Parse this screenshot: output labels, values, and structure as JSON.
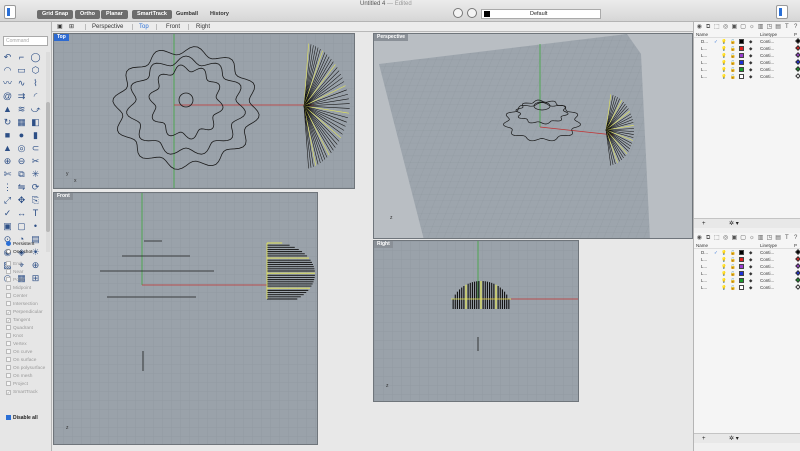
{
  "window": {
    "title": "Untitled 4",
    "status": "— Edited"
  },
  "toolbar": {
    "snaps": [
      {
        "label": "Grid Snap",
        "active": true
      },
      {
        "label": "Ortho",
        "active": true
      },
      {
        "label": "Planar",
        "active": true
      },
      {
        "label": "SmartTrack",
        "active": true
      },
      {
        "label": "Gumball",
        "active": false
      },
      {
        "label": "History",
        "active": false
      }
    ],
    "current_layer": "Default"
  },
  "command": {
    "placeholder": "Command"
  },
  "tool_icons": [
    "curve-icon",
    "polyline-icon",
    "circle-icon",
    "arc-icon",
    "rectangle-icon",
    "polygon-icon",
    "freeform-icon",
    "interpolate-icon",
    "helix-icon",
    "spiral-icon",
    "offset-icon",
    "fillet-icon",
    "extrude-icon",
    "loft-icon",
    "sweep-icon",
    "revolve-icon",
    "network-icon",
    "patch-icon",
    "box-icon",
    "sphere-icon",
    "cylinder-icon",
    "cone-icon",
    "torus-icon",
    "pipe-icon",
    "boolean-union-icon",
    "boolean-diff-icon",
    "split-icon",
    "trim-icon",
    "join-icon",
    "explode-icon",
    "array-icon",
    "mirror-icon",
    "rotate-icon",
    "scale-icon",
    "move-icon",
    "copy-icon",
    "check-icon",
    "dimension-icon",
    "text-icon",
    "group-icon",
    "ungroup-icon",
    "point-icon",
    "analyze-icon",
    "curvature-icon",
    "zebra-icon",
    "render-icon",
    "material-icon",
    "light-icon",
    "snapshot-icon",
    "camera-icon",
    "zoom-icon",
    "target-icon",
    "grid-icon",
    "cplane-icon"
  ],
  "tool_glyphs": [
    "↶",
    "⌐",
    "◯",
    "◠",
    "▭",
    "⬡",
    "〰",
    "∿",
    "⌇",
    "@",
    "⇉",
    "◜",
    "▲",
    "≋",
    "⤻",
    "↻",
    "▦",
    "◧",
    "■",
    "●",
    "▮",
    "▲",
    "◎",
    "⊂",
    "⊕",
    "⊖",
    "✂",
    "✄",
    "⧉",
    "✳",
    "⋮",
    "⇋",
    "⟳",
    "⤢",
    "✥",
    "⎘",
    "✓",
    "↔",
    "T",
    "▣",
    "▢",
    "•",
    "⊙",
    "◔",
    "▤",
    "◉",
    "◈",
    "☀",
    "▧",
    "⌖",
    "⊕",
    "◎",
    "▦",
    "⊞"
  ],
  "osnap": {
    "modes": [
      {
        "label": "Persistent",
        "selected": true
      },
      {
        "label": "One shot",
        "selected": false
      }
    ],
    "items": [
      {
        "label": "End",
        "checked": false
      },
      {
        "label": "Near",
        "checked": false
      },
      {
        "label": "Point",
        "checked": false
      },
      {
        "label": "Midpoint",
        "checked": false
      },
      {
        "label": "Center",
        "checked": false
      },
      {
        "label": "Intersection",
        "checked": false
      },
      {
        "label": "Perpendicular",
        "checked": true
      },
      {
        "label": "Tangent",
        "checked": true
      },
      {
        "label": "Quadrant",
        "checked": false
      },
      {
        "label": "Knot",
        "checked": false
      },
      {
        "label": "Vertex",
        "checked": false
      },
      {
        "label": "On curve",
        "checked": false
      },
      {
        "label": "On surface",
        "checked": false
      },
      {
        "label": "On polysurface",
        "checked": false
      },
      {
        "label": "On mesh",
        "checked": false
      },
      {
        "label": "Project",
        "checked": false
      },
      {
        "label": "SmartTrack",
        "checked": true
      }
    ],
    "disable_all": "Disable all"
  },
  "viewport_tabs": [
    {
      "label": "Perspective",
      "active": false
    },
    {
      "label": "Top",
      "active": true
    },
    {
      "label": "Front",
      "active": false
    },
    {
      "label": "Right",
      "active": false
    }
  ],
  "viewports": {
    "top": {
      "label": "Top"
    },
    "perspective": {
      "label": "Perspective"
    },
    "front": {
      "label": "Front"
    },
    "right": {
      "label": "Right"
    }
  },
  "layers": {
    "columns": [
      "Name",
      "Linetype",
      "P"
    ],
    "rows": [
      {
        "name": "D...",
        "linetype": "Conti... ",
        "color": "#000000"
      },
      {
        "name": "L...",
        "linetype": "Conti... ",
        "color": "#e02020"
      },
      {
        "name": "L...",
        "linetype": "Conti... ",
        "color": "#9a3cd0"
      },
      {
        "name": "L...",
        "linetype": "Conti... ",
        "color": "#1c2fd8"
      },
      {
        "name": "L...",
        "linetype": "Conti... ",
        "color": "#1a9a2a"
      },
      {
        "name": "L...",
        "linetype": "Conti... ",
        "color": "#ffffff"
      }
    ],
    "footer_add": "+",
    "footer_gear": "✲ ▾"
  }
}
